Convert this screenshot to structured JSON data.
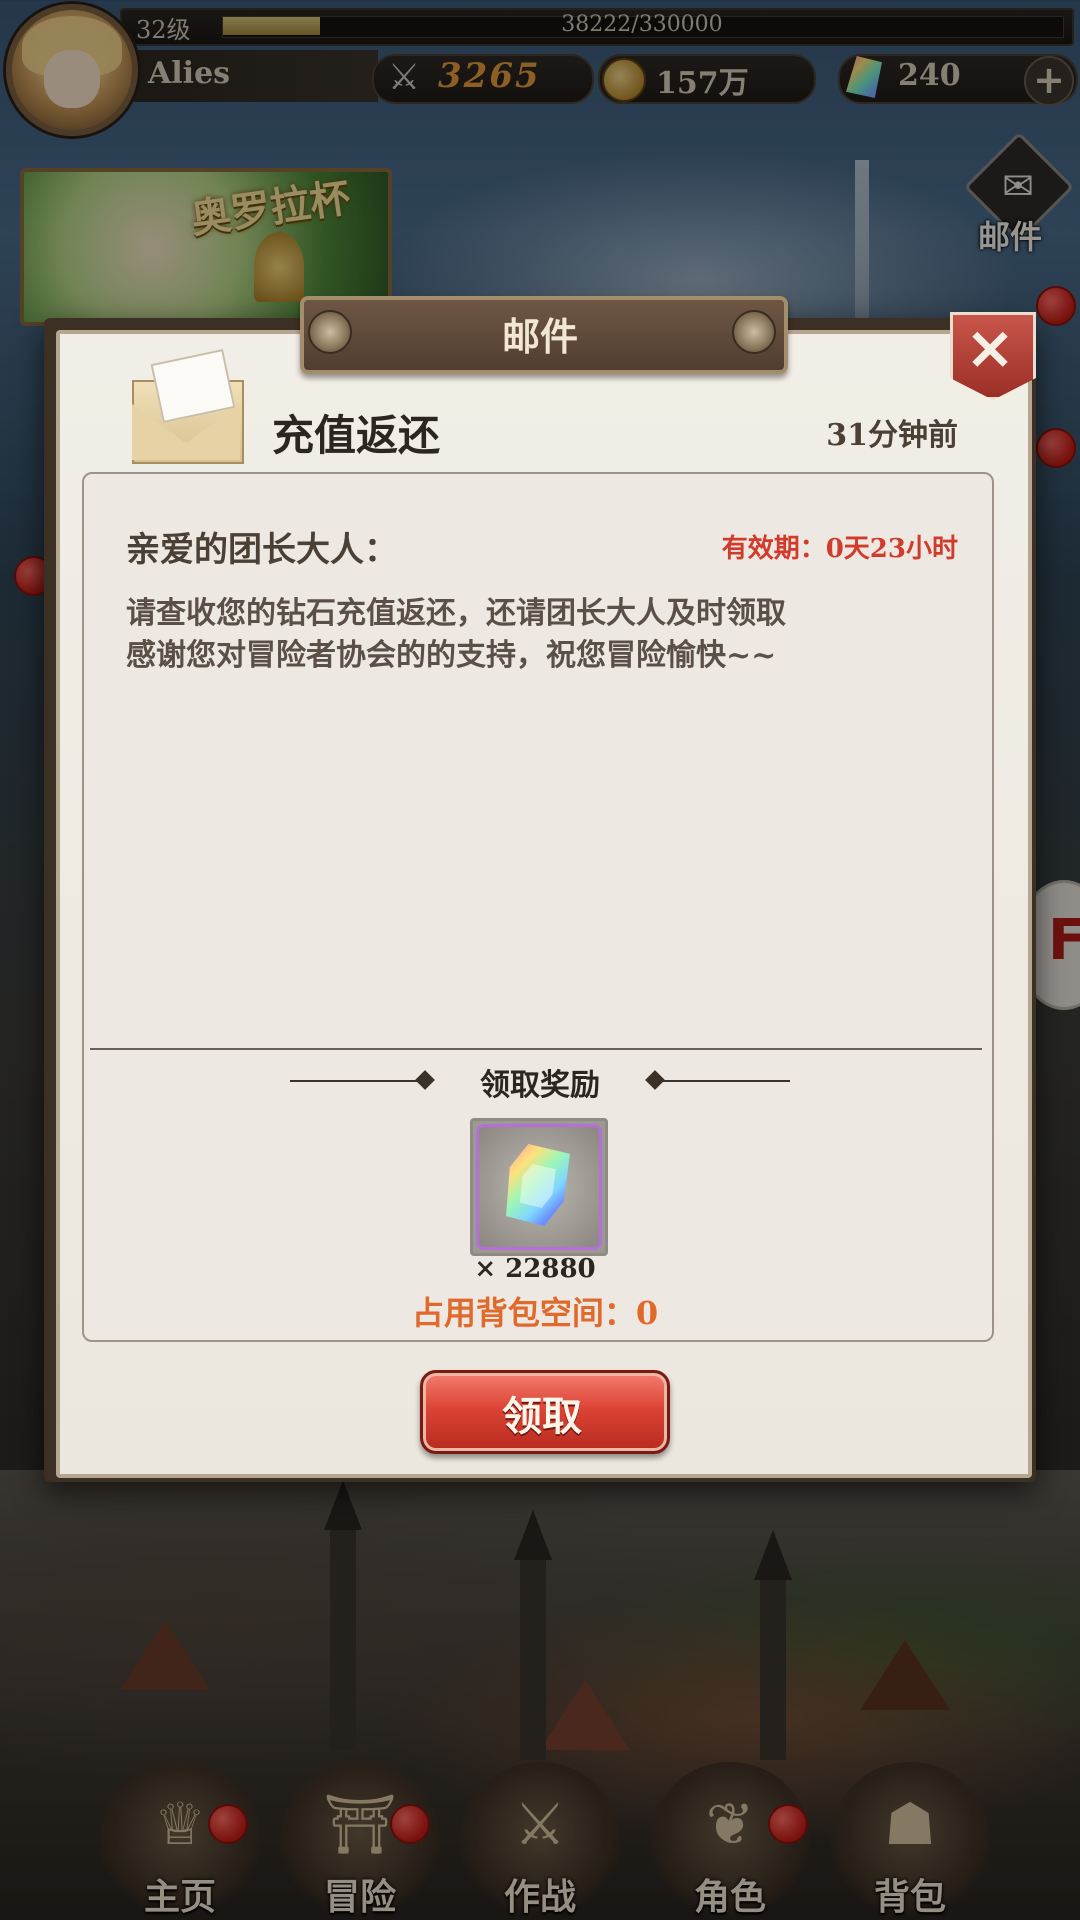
{
  "player": {
    "level_label": "32级",
    "name": "Alies",
    "exp_text": "38222/330000",
    "exp_fraction": 0.116
  },
  "resources": {
    "power": "3265",
    "gold": "157万",
    "gems": "240"
  },
  "side": {
    "event_banner_title": "奥罗拉杯",
    "mail_label": "邮件",
    "edge_letter": "F"
  },
  "dialog": {
    "title": "邮件",
    "subject": "充值返还",
    "time": "31分钟前",
    "greeting": "亲爱的团长大人：",
    "expiry": "有效期：0天23小时",
    "body": [
      "请查收您的钻石充值返还，还请团长大人及时领取",
      "感谢您对冒险者协会的的支持，祝您冒险愉快~~"
    ],
    "reward_title": "领取奖励",
    "reward_count": "× 22880",
    "bag_space": "占用背包空间：0",
    "claim_label": "领取"
  },
  "nav": {
    "items": [
      {
        "label": "主页"
      },
      {
        "label": "冒险"
      },
      {
        "label": "作战"
      },
      {
        "label": "角色"
      },
      {
        "label": "背包"
      }
    ]
  },
  "colors": {
    "expiry": "#d23a2c",
    "bag_space": "#e0692b",
    "claim_button": "#dc4435"
  },
  "icons": {
    "power": "crossed-swords-icon",
    "gold": "gold-coin-icon",
    "gems": "diamond-icon",
    "mail": "envelope-icon",
    "close": "close-icon",
    "reward": "diamond-icon"
  }
}
